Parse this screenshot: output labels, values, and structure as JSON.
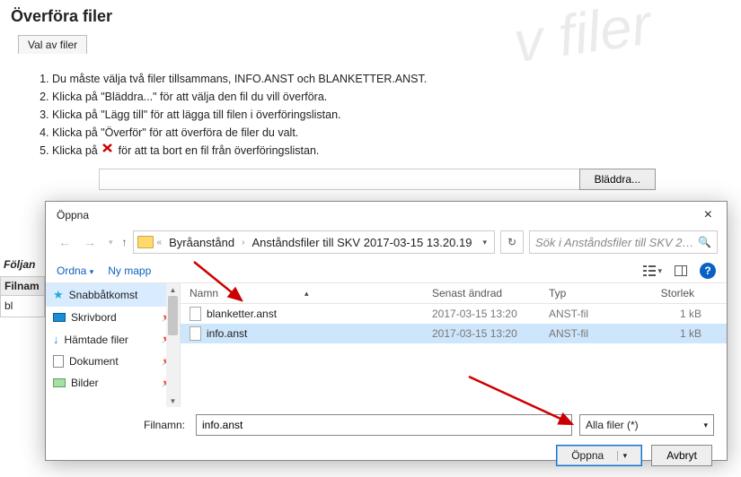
{
  "page": {
    "title": "Överföra filer",
    "tab": "Val av filer",
    "watermark": "v filer"
  },
  "instructions": [
    "Du måste välja två filer tillsammans, INFO.ANST och BLANKETTER.ANST.",
    "Klicka på \"Bläddra...\" för att välja den fil du vill överföra.",
    "Klicka på \"Lägg till\" för att lägga till filen i överföringslistan.",
    "Klicka på \"Överför\" för att överföra de filer du valt.",
    "Klicka på {X} för att ta bort en fil från överföringslistan."
  ],
  "browse_btn": "Bläddra...",
  "partial": {
    "label": "Följan",
    "header": "Filnam",
    "cell": "bl"
  },
  "dialog": {
    "title": "Öppna",
    "breadcrumb": [
      "Byråanstånd",
      "Anståndsfiler till SKV 2017-03-15 13.20.19"
    ],
    "search_placeholder": "Sök i Anståndsfiler till SKV 201...",
    "toolbar": {
      "organize": "Ordna",
      "new_folder": "Ny mapp"
    },
    "sidebar": [
      {
        "label": "Snabbåtkomst",
        "selected": true,
        "icon": "star"
      },
      {
        "label": "Skrivbord",
        "pin": true,
        "icon": "desktop"
      },
      {
        "label": "Hämtade filer",
        "pin": true,
        "icon": "download"
      },
      {
        "label": "Dokument",
        "pin": true,
        "icon": "doc"
      },
      {
        "label": "Bilder",
        "pin": true,
        "icon": "pic"
      }
    ],
    "columns": {
      "name": "Namn",
      "date": "Senast ändrad",
      "type": "Typ",
      "size": "Storlek"
    },
    "files": [
      {
        "name": "blanketter.anst",
        "date": "2017-03-15 13:20",
        "type": "ANST-fil",
        "size": "1 kB",
        "selected": false
      },
      {
        "name": "info.anst",
        "date": "2017-03-15 13:20",
        "type": "ANST-fil",
        "size": "1 kB",
        "selected": true
      }
    ],
    "filename_label": "Filnamn:",
    "filename_value": "info.anst",
    "filter": "Alla filer (*)",
    "open_btn": "Öppna",
    "cancel_btn": "Avbryt"
  }
}
